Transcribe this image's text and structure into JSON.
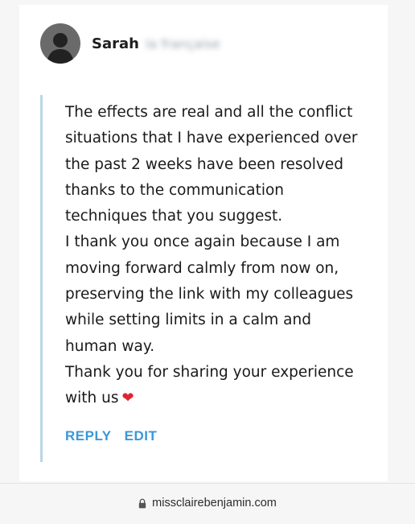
{
  "author": {
    "first_name": "Sarah",
    "surname": "la française"
  },
  "comment": {
    "lines": [
      "The effects are real and all the conflict",
      "situations that I have experienced over",
      "the past 2 weeks have been resolved",
      "thanks to the communication",
      "techniques that you suggest.",
      "I thank you once again because I am",
      "moving forward calmly from now on,",
      "preserving the link with my colleagues",
      "while setting limits in a calm and",
      "human way.",
      "Thank you for sharing your experience",
      "with us"
    ],
    "emoji": "❤"
  },
  "actions": {
    "reply_label": "REPLY",
    "edit_label": "EDIT"
  },
  "browser": {
    "url": "missclairebenjamin.com",
    "lock_icon": "lock-icon"
  },
  "colors": {
    "action_blue": "#3a98d8",
    "quote_border": "#b8d7e5",
    "heart_red": "#e0242f"
  }
}
